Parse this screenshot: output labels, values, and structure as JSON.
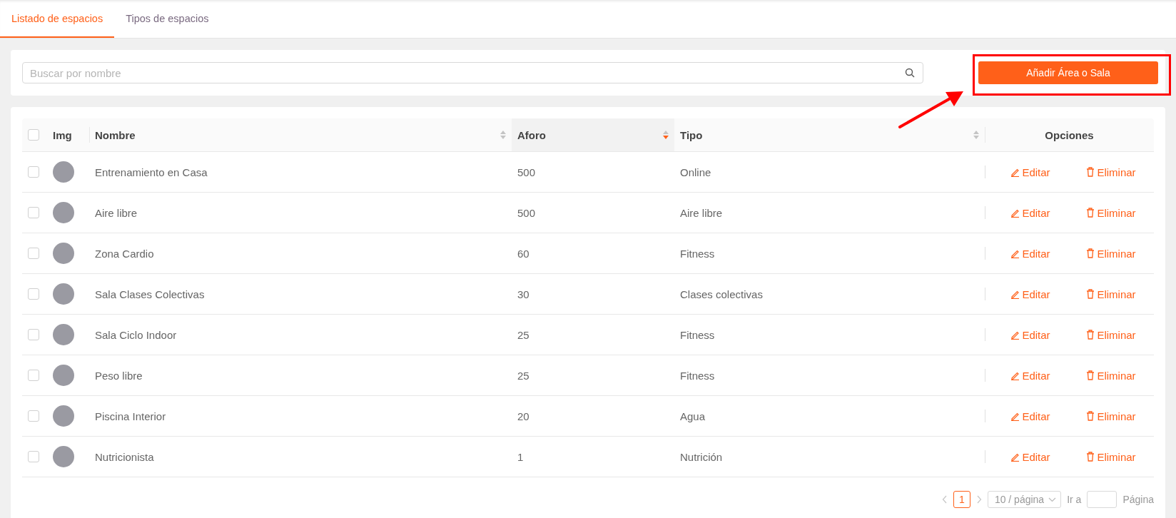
{
  "tabs": [
    {
      "label": "Listado de espacios",
      "selected": true
    },
    {
      "label": "Tipos de espacios",
      "selected": false
    }
  ],
  "search": {
    "placeholder": "Buscar por nombre"
  },
  "add_button": "Añadir Área o Sala",
  "annotation": {
    "kind": "highlight_arrow"
  },
  "table": {
    "select_all_checked": false,
    "columns": [
      {
        "label": "Img",
        "sortable": false
      },
      {
        "label": "Nombre",
        "sortable": true,
        "sorted_desc": false
      },
      {
        "label": "Aforo",
        "sortable": true,
        "sorted_desc": true
      },
      {
        "label": "Tipo",
        "sortable": true,
        "sorted_desc": false
      },
      {
        "label": "Opciones",
        "sortable": false
      }
    ],
    "rows": [
      {
        "checked": false,
        "name": "Entrenamiento en Casa",
        "capacity": "500",
        "type": "Online",
        "edit": "Editar",
        "delete": "Eliminar"
      },
      {
        "checked": false,
        "name": "Aire libre",
        "capacity": "500",
        "type": "Aire libre",
        "edit": "Editar",
        "delete": "Eliminar"
      },
      {
        "checked": false,
        "name": "Zona Cardio",
        "capacity": "60",
        "type": "Fitness",
        "edit": "Editar",
        "delete": "Eliminar"
      },
      {
        "checked": false,
        "name": "Sala Clases Colectivas",
        "capacity": "30",
        "type": "Clases colectivas",
        "edit": "Editar",
        "delete": "Eliminar"
      },
      {
        "checked": false,
        "name": "Sala Ciclo Indoor",
        "capacity": "25",
        "type": "Fitness",
        "edit": "Editar",
        "delete": "Eliminar"
      },
      {
        "checked": false,
        "name": "Peso libre",
        "capacity": "25",
        "type": "Fitness",
        "edit": "Editar",
        "delete": "Eliminar"
      },
      {
        "checked": false,
        "name": "Piscina Interior",
        "capacity": "20",
        "type": "Agua",
        "edit": "Editar",
        "delete": "Eliminar"
      },
      {
        "checked": false,
        "name": "Nutricionista",
        "capacity": "1",
        "type": "Nutrición",
        "edit": "Editar",
        "delete": "Eliminar"
      }
    ]
  },
  "pagination": {
    "pages": [
      {
        "label": "1",
        "selected": true
      }
    ],
    "page_size": "10 / página",
    "goto_label": "Ir a",
    "goto_suffix": "Página"
  }
}
